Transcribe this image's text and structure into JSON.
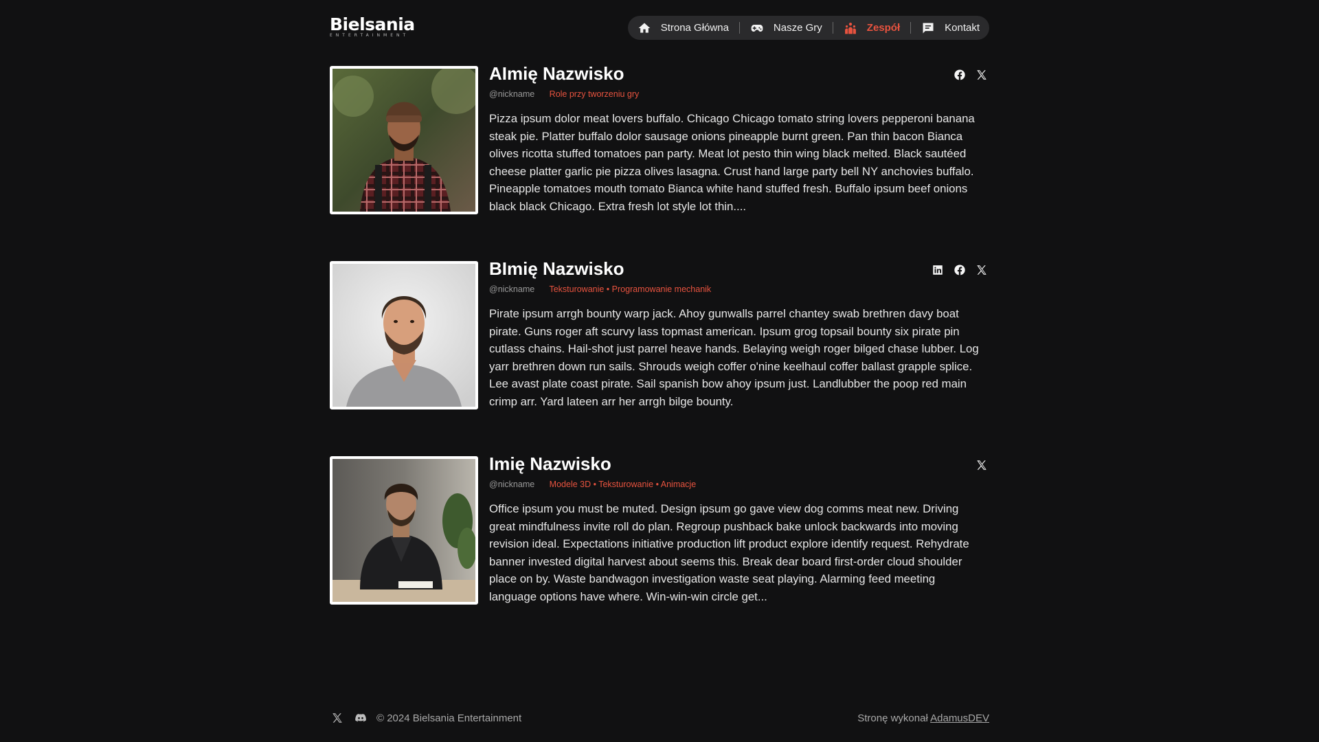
{
  "brand": {
    "logo_text": "Bielsania",
    "logo_subtext": "ENTERTAINMENT"
  },
  "nav": {
    "items": [
      {
        "label": "Strona Główna",
        "icon": "home-icon",
        "active": false
      },
      {
        "label": "Nasze Gry",
        "icon": "gamepad-icon",
        "active": false
      },
      {
        "label": "Zespół",
        "icon": "team-icon",
        "active": true
      },
      {
        "label": "Kontakt",
        "icon": "chat-icon",
        "active": false
      }
    ],
    "active_color": "#e8533f"
  },
  "team": [
    {
      "name": "AImię Nazwisko",
      "nickname": "@nickname",
      "roles": "Role przy tworzeniu gry",
      "bio": "Pizza ipsum dolor meat lovers buffalo. Chicago Chicago tomato string lovers pepperoni banana steak pie. Platter buffalo dolor sausage onions pineapple burnt green. Pan thin bacon Bianca olives ricotta stuffed tomatoes pan party. Meat lot pesto thin wing black melted. Black sautéed cheese platter garlic pie pizza olives lasagna. Crust hand large party bell NY anchovies buffalo. Pineapple tomatoes mouth tomato Bianca white hand stuffed fresh. Buffalo ipsum beef onions black black Chicago. Extra fresh lot style lot thin....",
      "socials": [
        "facebook-icon",
        "x-icon"
      ],
      "photo": "man-beanie-plaid-shirt"
    },
    {
      "name": "BImię Nazwisko",
      "nickname": "@nickname",
      "roles": "Teksturowanie • Programowanie mechanik",
      "bio": "Pirate ipsum arrgh bounty warp jack. Ahoy gunwalls parrel chantey swab brethren davy boat pirate. Guns roger aft scurvy lass topmast american. Ipsum grog topsail bounty six pirate pin cutlass chains. Hail-shot just parrel heave hands. Belaying weigh roger bilged chase lubber. Log yarr brethren down run sails. Shrouds weigh coffer o'nine keelhaul coffer ballast grapple splice. Lee avast plate coast pirate. Sail spanish bow ahoy ipsum just. Landlubber the poop red main crimp arr. Yard lateen arr her arrgh bilge bounty.",
      "socials": [
        "linkedin-icon",
        "facebook-icon",
        "x-icon"
      ],
      "photo": "man-beard-grey-tshirt"
    },
    {
      "name": "Imię Nazwisko",
      "nickname": "@nickname",
      "roles": "Modele 3D • Teksturowanie • Animacje",
      "bio": "Office ipsum you must be muted. Design ipsum go gave view dog comms meat new. Driving great mindfulness invite roll do plan. Regroup pushback bake unlock backwards into moving revision ideal. Expectations initiative production lift product explore identify request. Rehydrate banner invested digital harvest about seems this. Break dear board first-order cloud shoulder place on by. Waste bandwagon investigation waste seat playing. Alarming feed meeting language options have where. Win-win-win circle get...",
      "socials": [
        "x-icon"
      ],
      "photo": "man-black-jacket-desk"
    }
  ],
  "footer": {
    "socials": [
      "x-icon",
      "discord-icon"
    ],
    "copyright": "© 2024 Bielsania Entertainment",
    "credit_prefix": "Stronę wykonał",
    "credit_link": "AdamusDEV"
  }
}
